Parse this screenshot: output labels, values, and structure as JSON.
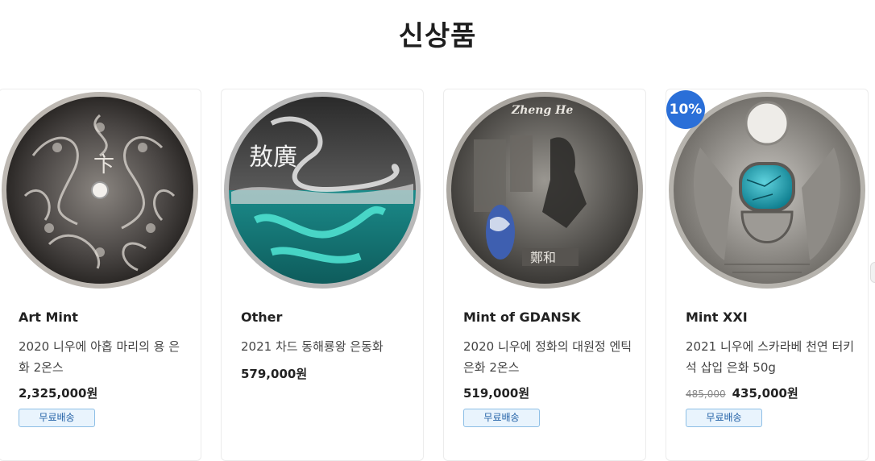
{
  "section": {
    "title": "신상품"
  },
  "products": [
    {
      "brand": "Art Mint",
      "name": "2020 니우에 아홉 마리의 용 은화 2온스",
      "price": "2,325,000원",
      "old_price": "",
      "badge": "무료배송"
    },
    {
      "brand": "Other",
      "name": "2021 차드 동해룡왕 은동화",
      "price": "579,000원",
      "old_price": "",
      "badge": ""
    },
    {
      "brand": "Mint of GDANSK",
      "name": "2020 니우에 정화의 대원정 엔틱 은화 2온스",
      "price": "519,000원",
      "old_price": "",
      "badge": "무료배송",
      "coin_text": "Zheng He"
    },
    {
      "brand": "Mint XXI",
      "name": "2021 니우에 스카라베 천연 터키석 삽입 은화 50g",
      "price": "435,000원",
      "old_price": "485,000",
      "badge": "무료배송",
      "discount": "10%"
    }
  ],
  "colors": {
    "badge_bg": "#e9f4fd",
    "badge_border": "#8ebfe6",
    "discount_bg": "#2a6fd8",
    "turquoise": "#1ea3b5",
    "teal": "#1f8c8c"
  }
}
